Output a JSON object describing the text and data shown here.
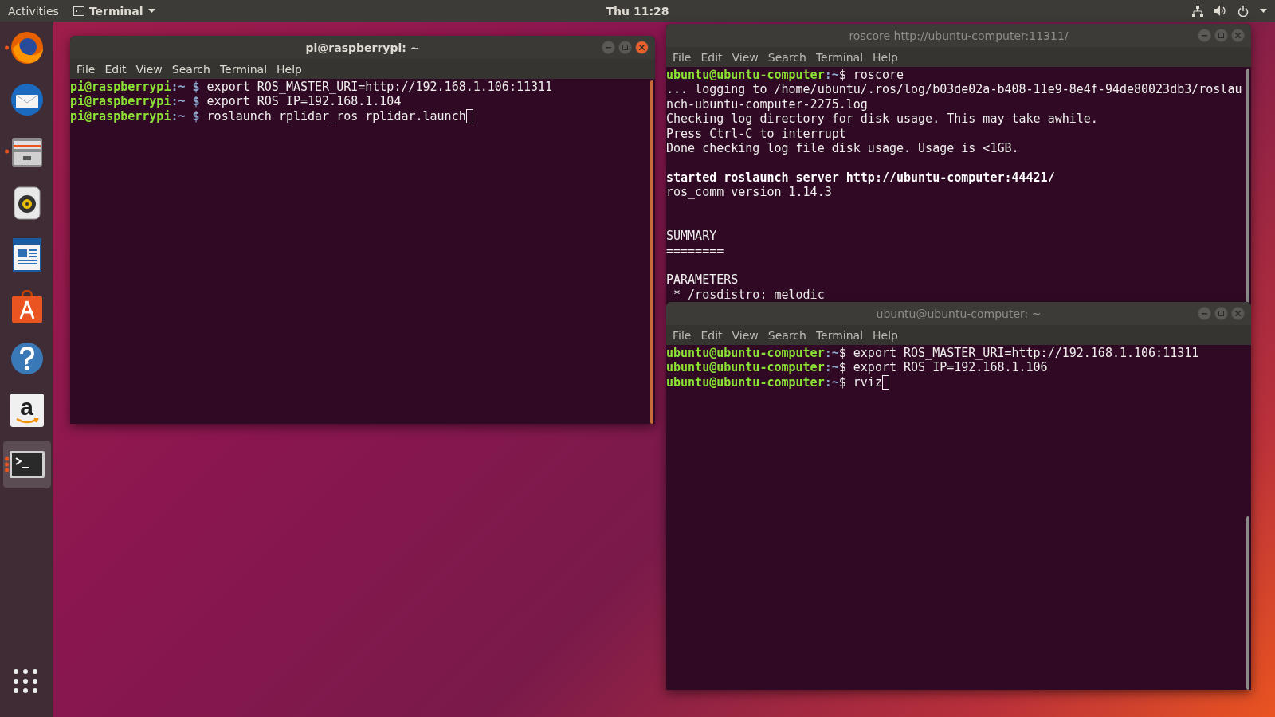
{
  "top_bar": {
    "activities": "Activities",
    "app_menu": "Terminal",
    "clock": "Thu 11:28"
  },
  "dock": {
    "items": [
      {
        "kind": "globe",
        "running": true,
        "selected": false
      },
      {
        "kind": "mail",
        "running": false,
        "selected": false
      },
      {
        "kind": "files",
        "running": true,
        "selected": false
      },
      {
        "kind": "speaker",
        "running": false,
        "selected": false
      },
      {
        "kind": "document",
        "running": false,
        "selected": false
      },
      {
        "kind": "bag",
        "running": false,
        "selected": false
      },
      {
        "kind": "help",
        "running": false,
        "selected": false
      },
      {
        "kind": "store",
        "glyph": "a",
        "running": false,
        "selected": false
      },
      {
        "kind": "terminal",
        "running": true,
        "multiple": true,
        "selected": true
      }
    ]
  },
  "windows": [
    {
      "title": "pi@raspberrypi: ~",
      "focused": true,
      "scrolled": false,
      "cursor": true,
      "menu": [
        "File",
        "Edit",
        "View",
        "Search",
        "Terminal",
        "Help"
      ],
      "lines": [
        {
          "segments": [
            {
              "kind": "user",
              "text": "pi@raspberrypi"
            },
            {
              "kind": "path",
              "text": ":~ $ "
            },
            {
              "kind": "text",
              "text": "export ROS_MASTER_URI=http://192.168.1.106:11311"
            }
          ]
        },
        {
          "segments": [
            {
              "kind": "user",
              "text": "pi@raspberrypi"
            },
            {
              "kind": "path",
              "text": ":~ $ "
            },
            {
              "kind": "text",
              "text": "export ROS_IP=192.168.1.104"
            }
          ]
        },
        {
          "segments": [
            {
              "kind": "user",
              "text": "pi@raspberrypi"
            },
            {
              "kind": "path",
              "text": ":~ $ "
            },
            {
              "kind": "text",
              "text": "roslaunch rplidar_ros rplidar.launch"
            }
          ]
        }
      ]
    },
    {
      "title": "roscore http://ubuntu-computer:11311/",
      "focused": false,
      "scrolled": false,
      "cursor": false,
      "menu": [
        "File",
        "Edit",
        "View",
        "Search",
        "Terminal",
        "Help"
      ],
      "lines": [
        {
          "segments": [
            {
              "kind": "user",
              "text": "ubuntu@ubuntu-computer"
            },
            {
              "kind": "path",
              "text": ":~"
            },
            {
              "kind": "text",
              "text": "$ roscore"
            }
          ]
        },
        {
          "segments": [
            {
              "kind": "text",
              "text": "... logging to /home/ubuntu/.ros/log/b03de02a-b408-11e9-8e4f-94de80023db3/roslau"
            }
          ]
        },
        {
          "segments": [
            {
              "kind": "text",
              "text": "nch-ubuntu-computer-2275.log"
            }
          ]
        },
        {
          "segments": [
            {
              "kind": "text",
              "text": "Checking log directory for disk usage. This may take awhile."
            }
          ]
        },
        {
          "segments": [
            {
              "kind": "text",
              "text": "Press Ctrl-C to interrupt"
            }
          ]
        },
        {
          "segments": [
            {
              "kind": "text",
              "text": "Done checking log file disk usage. Usage is <1GB."
            }
          ]
        },
        {
          "blank_before": true,
          "segments": [
            {
              "kind": "bold",
              "text": "started roslaunch server http://ubuntu-computer:44421/"
            }
          ]
        },
        {
          "blank_after": true,
          "segments": [
            {
              "kind": "text",
              "text": "ros_comm version 1.14.3"
            }
          ]
        },
        {
          "blank_before": true,
          "segments": [
            {
              "kind": "text",
              "text": "SUMMARY"
            }
          ]
        },
        {
          "segments": [
            {
              "kind": "text",
              "text": "========"
            }
          ]
        },
        {
          "blank_before": true,
          "segments": [
            {
              "kind": "text",
              "text": "PARAMETERS"
            }
          ]
        },
        {
          "segments": [
            {
              "kind": "text",
              "text": " * /rosdistro: melodic"
            }
          ]
        }
      ]
    },
    {
      "title": "ubuntu@ubuntu-computer: ~",
      "focused": false,
      "scrolled": true,
      "cursor": true,
      "menu": [
        "File",
        "Edit",
        "View",
        "Search",
        "Terminal",
        "Help"
      ],
      "lines": [
        {
          "segments": [
            {
              "kind": "user",
              "text": "ubuntu@ubuntu-computer"
            },
            {
              "kind": "path",
              "text": ":~"
            },
            {
              "kind": "text",
              "text": "$ export ROS_MASTER_URI=http://192.168.1.106:11311"
            }
          ]
        },
        {
          "segments": [
            {
              "kind": "user",
              "text": "ubuntu@ubuntu-computer"
            },
            {
              "kind": "path",
              "text": ":~"
            },
            {
              "kind": "text",
              "text": "$ export ROS_IP=192.168.1.106"
            }
          ]
        },
        {
          "segments": [
            {
              "kind": "user",
              "text": "ubuntu@ubuntu-computer"
            },
            {
              "kind": "path",
              "text": ":~"
            },
            {
              "kind": "text",
              "text": "$ rviz"
            }
          ]
        }
      ]
    }
  ]
}
